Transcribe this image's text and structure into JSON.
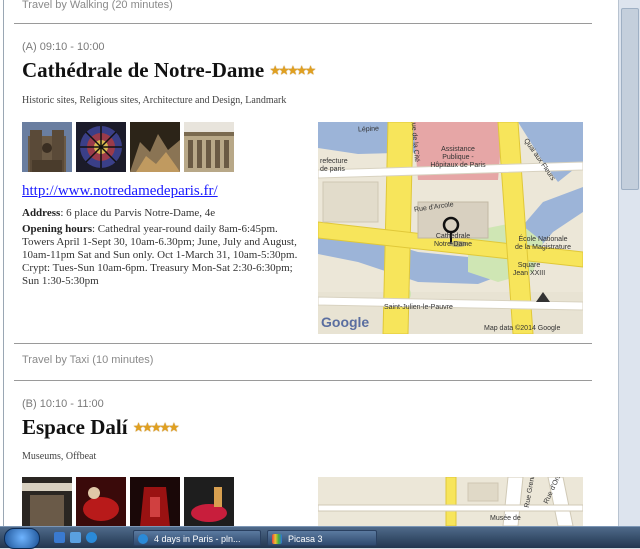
{
  "travel": [
    {
      "text": "Travel by Walking (20 minutes)"
    },
    {
      "text": "Travel by Taxi (10 minutes)"
    }
  ],
  "stops": [
    {
      "time": "(A) 09:10 - 10:00",
      "title": "Cathédrale de Notre-Dame",
      "stars": "★★★★★",
      "categories": "Historic sites, Religious sites, Architecture and Design, Landmark",
      "url": "http://www.notredamedeparis.fr/",
      "address_label": "Address",
      "address": ": 6 place du Parvis Notre-Dame, 4e",
      "hours_label": "Opening hours",
      "hours": ": Cathedral year-round daily 8am-6:45pm. Towers April 1-Sept 30, 10am-6.30pm; June, July and August, 10am-11pm Sat and Sun only. Oct 1-March 31, 10am-5:30pm. Crypt: Tues-Sun 10am-6pm. Treasury Mon-Sat 2:30-6:30pm; Sun 1:30-5:30pm"
    },
    {
      "time": "(B) 10:10 - 11:00",
      "title": "Espace Dalí",
      "stars": "★★★★★",
      "categories": "Museums, Offbeat"
    }
  ],
  "map1": {
    "labels": {
      "lepine": "Lépine",
      "prefecture": "refecture\nde paris",
      "assistance": "Assistance\nPublique -\nHôpitaux de Paris",
      "quai": "Quai aux Fleurs",
      "cathedrale": "Cathédrale\nNotre-Dame",
      "ecole": "École Nationale\nde la Magistrature",
      "square": "Square\nJean XXIII",
      "julien": "Saint-Julien-le-Pauvre",
      "rue_cite": "Rue de la Cité",
      "rue_arcole": "Rue d'Arcole",
      "google": "Google",
      "mapdata": "Map data ©2014 Google"
    }
  },
  "map2": {
    "labels": {
      "rue_grenier": "Rue Grenier",
      "rue_musee": "Musée de",
      "rue_orsel": "Rue d'Orsel"
    }
  },
  "taskbar": {
    "window1": "4 days in Paris - pln...",
    "window2": "Picasa 3"
  },
  "colors": {
    "star": "#e0a020",
    "link": "#1a1aff",
    "road_major": "#f7e55b",
    "river": "#9cb4d8",
    "park": "#cfe6b4"
  }
}
